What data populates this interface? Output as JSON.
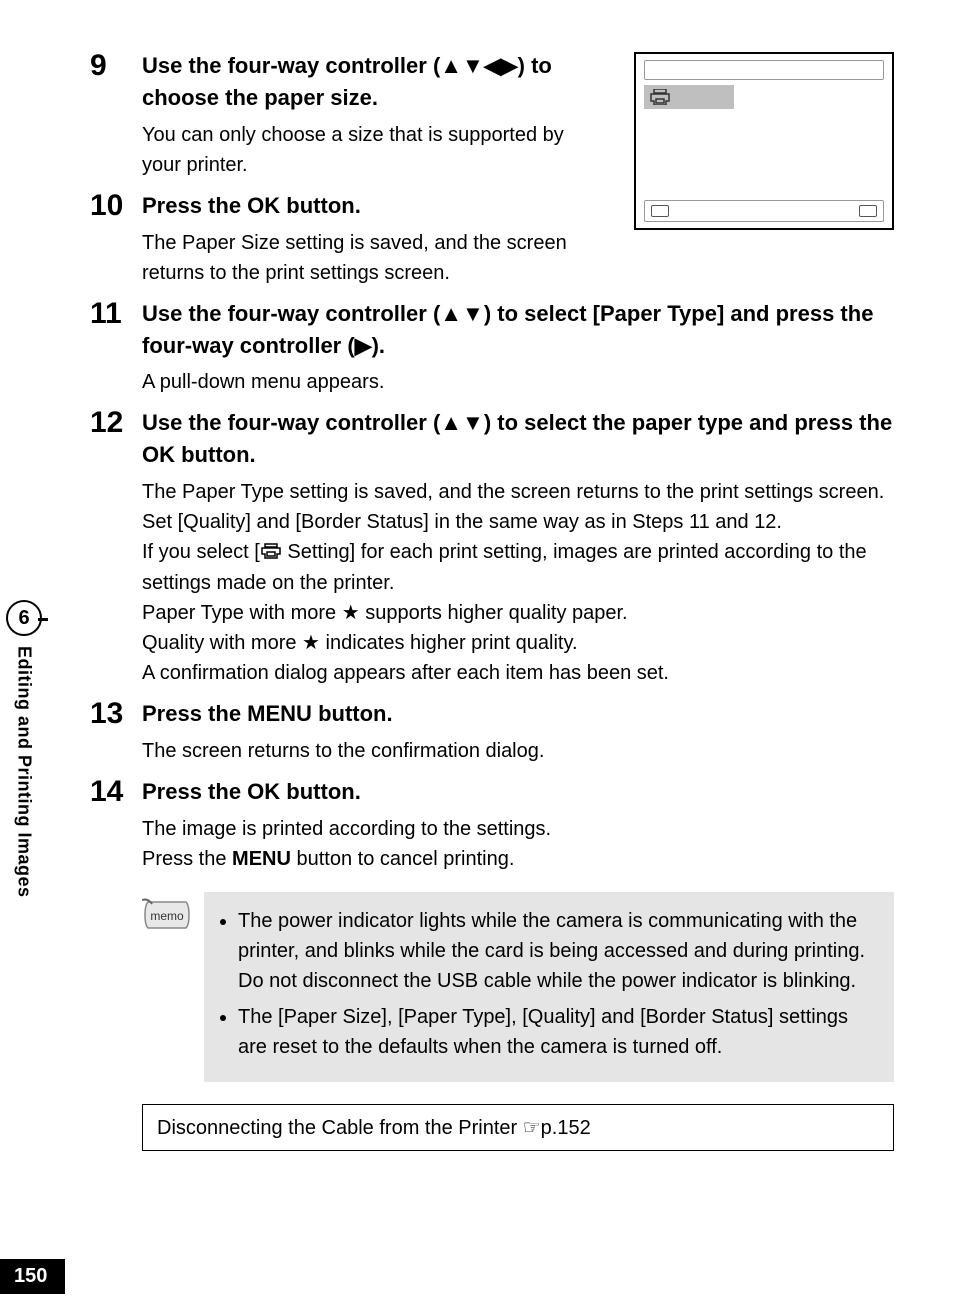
{
  "sidebar": {
    "chapter_number": "6",
    "chapter_title": "Editing and Printing Images"
  },
  "page_number": "150",
  "steps": [
    {
      "num": "9",
      "title_pre": "Use the four-way controller (",
      "title_arrows": "▲▼◀▶",
      "title_post": ") to choose the paper size.",
      "desc": "You can only choose a size that is supported by your printer."
    },
    {
      "num": "10",
      "title_pre": "Press the ",
      "title_btn": "OK",
      "title_post": " button.",
      "desc": "The Paper Size setting is saved, and the screen returns to the print settings screen."
    },
    {
      "num": "11",
      "title_pre": "Use the four-way controller (",
      "title_arrows": "▲▼",
      "title_mid": ") to select [Paper Type] and press the four-way controller (",
      "title_arrows2": "▶",
      "title_post": ").",
      "desc": "A pull-down menu appears."
    },
    {
      "num": "12",
      "title_pre": "Use the four-way controller (",
      "title_arrows": "▲▼",
      "title_mid": ") to select the paper type and press the ",
      "title_btn": "OK",
      "title_post": " button.",
      "desc_a": "The Paper Type setting is saved, and the screen returns to the print settings screen. Set [Quality] and [Border Status] in the same way as in Steps 11 and 12.",
      "desc_b_pre": "If you select [",
      "desc_b_post": " Setting] for each print setting, images are printed according to the settings made on the printer.",
      "desc_c": "Paper Type with more ★ supports higher quality paper.",
      "desc_d": "Quality with more ★ indicates higher print quality.",
      "desc_e": "A confirmation dialog appears after each item has been set."
    },
    {
      "num": "13",
      "title_pre": "Press the ",
      "title_btn": "MENU",
      "title_post": " button.",
      "desc": "The screen returns to the confirmation dialog."
    },
    {
      "num": "14",
      "title_pre": "Press the ",
      "title_btn": "OK",
      "title_post": " button.",
      "desc_a": "The image is printed according to the settings.",
      "desc_b_pre": "Press the ",
      "desc_b_btn": "MENU",
      "desc_b_post": " button to cancel printing."
    }
  ],
  "memo": {
    "label": "memo",
    "items": [
      "The power indicator lights while the camera is communicating with the printer, and blinks while the card is being accessed and during printing. Do not disconnect the USB cable while the power indicator is blinking.",
      "The [Paper Size], [Paper Type], [Quality] and [Border Status] settings are reset to the defaults when the camera is turned off."
    ]
  },
  "ref": {
    "text": "Disconnecting the Cable from the Printer ☞p.152"
  }
}
